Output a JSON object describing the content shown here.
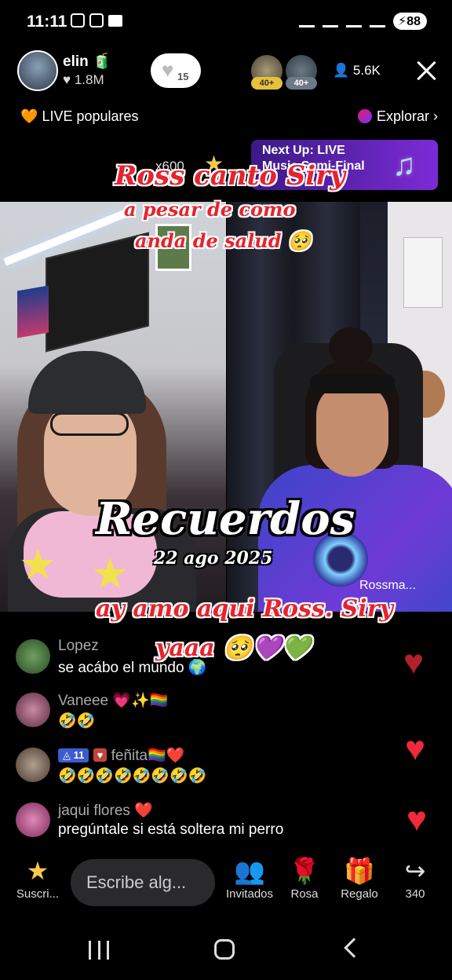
{
  "status_bar": {
    "time": "11:11",
    "battery": "88"
  },
  "header": {
    "host_name": "elin",
    "host_likes": "1.8M",
    "follow_count": "15",
    "viewer_badges": [
      "40+",
      "40+"
    ],
    "viewer_count": "5.6K"
  },
  "subbar": {
    "popular_label": "LIVE populares",
    "explore_label": "Explorar"
  },
  "next_up": {
    "title": "Next Up: LIVE",
    "subtitle": "Music Semi-Final"
  },
  "gift_multiplier": "x600",
  "captions": {
    "line1": "Ross canto Siry",
    "line2": "a pesar de como",
    "line3": "anda de salud 🥺",
    "headline": "Recuerdos",
    "date": "22 ago 2025",
    "line4": "ay amo aqui Ross.  Siry",
    "line5": "yaaa 🥺💜💚"
  },
  "guest_name": "Rossma...",
  "comments": [
    {
      "user": "Lopez",
      "text": "se acábo el mundo 🌍",
      "avatar_color": "#3f6b3a"
    },
    {
      "user": "Vaneee 💗✨🏳️‍🌈",
      "text": "🤣🤣",
      "avatar_color": "#8a3a5a"
    },
    {
      "level": "11",
      "user": "feñita🏳️‍🌈❤️",
      "text": "🤣🤣🤣🤣🤣🤣🤣🤣",
      "avatar_color": "#6a5a50"
    },
    {
      "user": "jaqui flores ❤️",
      "text": "pregúntale si está soltera mi perro",
      "avatar_color": "#b04a7a"
    }
  ],
  "actions": {
    "subscribe_label": "Suscri...",
    "comment_placeholder": "Escribe alg...",
    "guests_label": "Invitados",
    "rose_label": "Rosa",
    "gift_label": "Regalo",
    "share_count": "340"
  },
  "colors": {
    "caption_red": "#e5242e",
    "like_red": "#ee2a3c",
    "banner_purple": "#5a25b0"
  }
}
